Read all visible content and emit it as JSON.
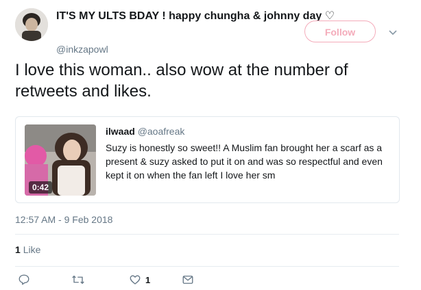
{
  "user": {
    "display_name": "IT'S MY ULTS BDAY ! happy chungha & johnny day ♡",
    "handle": "@inkzapowl",
    "avatar": "avatar-photo"
  },
  "follow_button": {
    "label": "Follow",
    "color": "#f4abba"
  },
  "tweet": {
    "text": "I love this woman.. also wow at the number of retweets and likes."
  },
  "quote": {
    "author_name": "ilwaad",
    "author_handle": "@aoafreak",
    "text": "Suzy is honestly so sweet!! A Muslim fan brought her a scarf as a present & suzy asked to put it on and was so respectful and even kept it on when the fan left I love her sm",
    "media_duration": "0:42"
  },
  "timestamp": "12:57 AM - 9 Feb 2018",
  "stats": {
    "likes_count": "1",
    "likes_label": "Like"
  },
  "actions": {
    "reply_icon": "reply-icon",
    "retweet_icon": "retweet-icon",
    "like_icon": "heart-icon",
    "like_count": "1",
    "dm_icon": "envelope-icon"
  }
}
